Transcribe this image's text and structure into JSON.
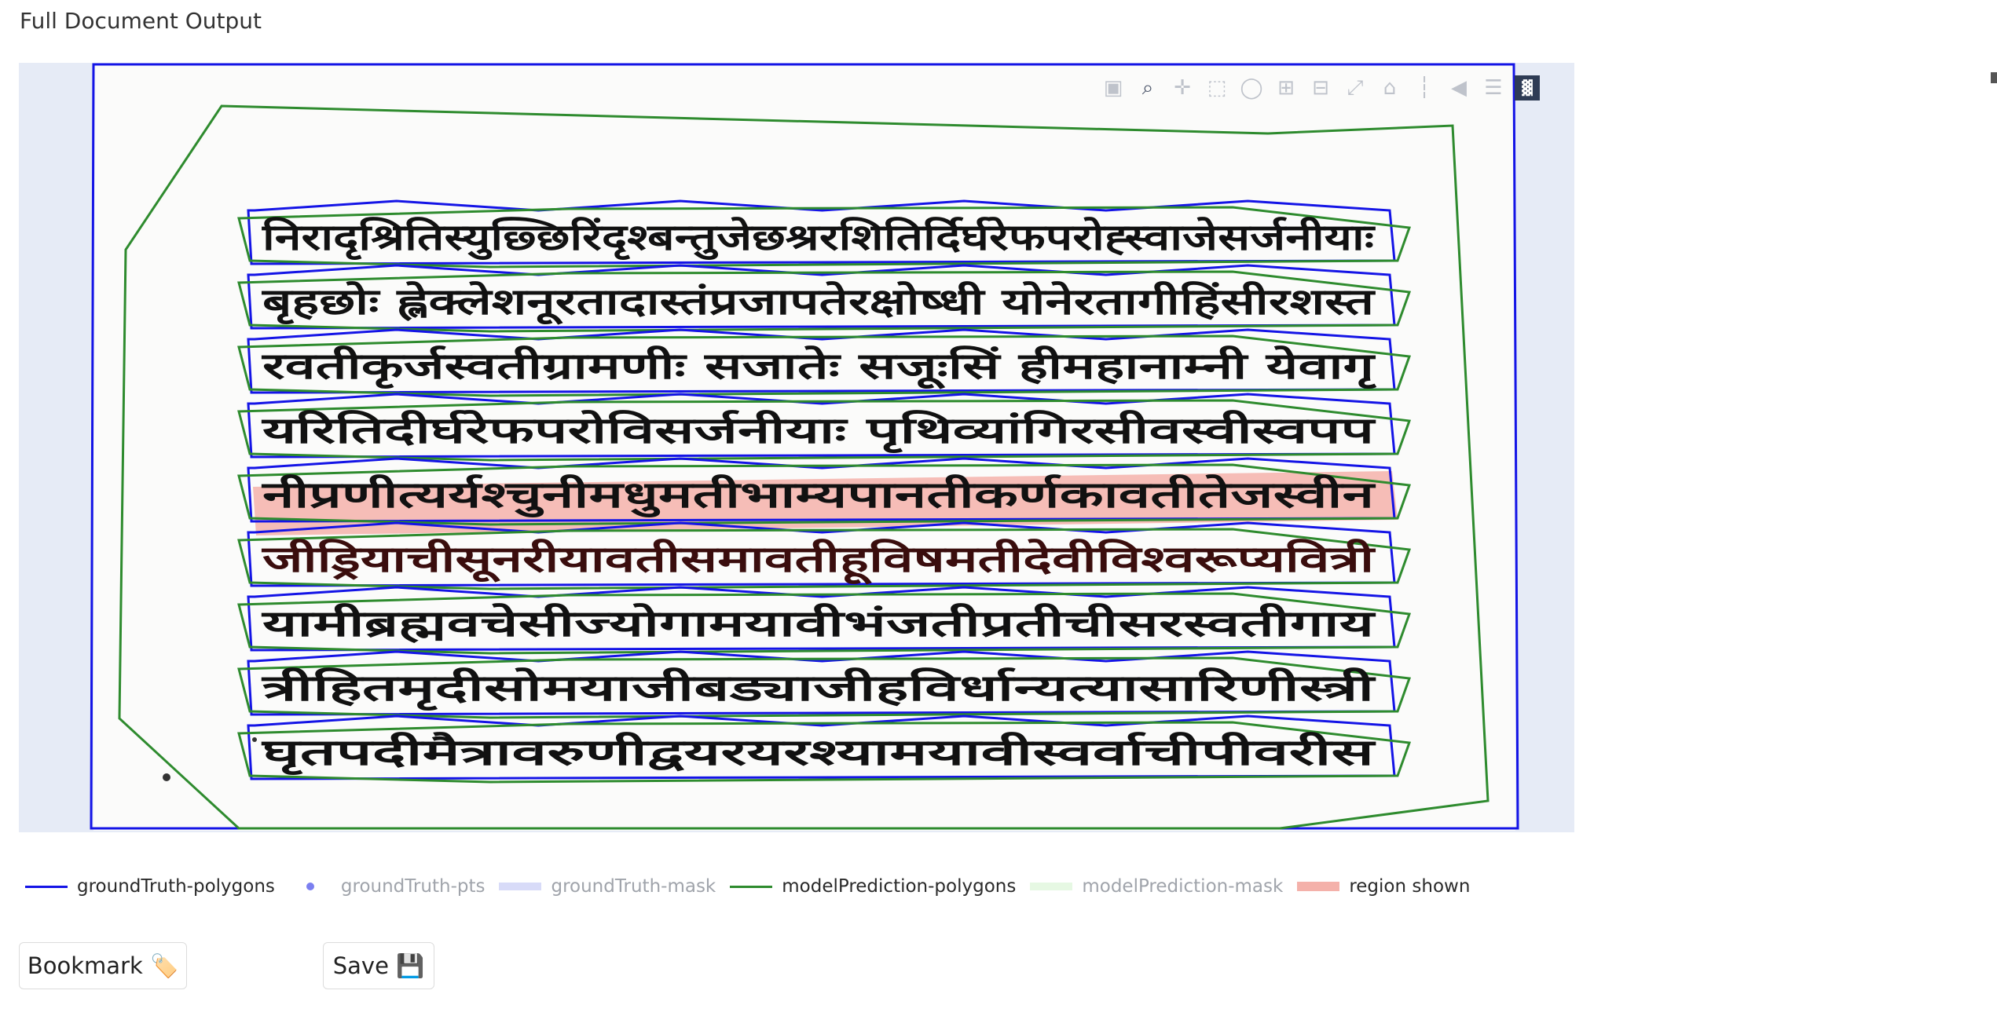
{
  "header": {
    "title": "Full Document Output"
  },
  "colors": {
    "groundtruth": "#1414e6",
    "prediction": "#2e8b2e",
    "region_shown": "#f4b1aa",
    "plot_bg": "#e6ebf6"
  },
  "modebar": {
    "buttons": [
      "camera-icon",
      "zoom-icon",
      "pan-icon",
      "box-select-icon",
      "lasso-select-icon",
      "zoom-in-icon",
      "zoom-out-icon",
      "autoscale-icon",
      "reset-axes-icon",
      "spike-lines-icon",
      "hover-closest-icon",
      "hover-compare-icon",
      "plotly-logo-icon"
    ],
    "active": "zoom-icon"
  },
  "document": {
    "script_lines": [
      "निरादृश्रितिस्युछ्छिरिंदृश्बन्तुजेछश्ररशितिर्दिर्घरेफपरोह्स्वाजेसर्जनीयाः",
      "बृहछोः ह्लेक्लेशनूरतादास्तंप्रजापतेरक्षोष्धी योनेरतागीहिंसीरशस्त",
      "रवतीकृर्जस्वतीग्रामणीः सजातेः सजूःसिं हीमहानाम्नी येवागृ",
      "यरितिदीर्घरेफपरोविसर्जनीयाः पृथिव्यांगिरसीवस्वीस्वपप",
      "नीप्रणीत्यर्यश्चुनीमधुमतीभाम्यपानतीकर्णकावतीतेजस्वीन",
      "जीड्रियाचीसूनरीयावतीसमावतीहूविषमतीदेवीविश्वरूप्यवित्री",
      "यामीब्रह्मवचेसीज्योगामयावीभंजतीप्रतीचीसरस्वतीगाय",
      "त्रीहितमृदीसोमयाजीबड्याजीहविर्धान्यत्यासारिणीस्त्री",
      "घृतपदीमैत्रावरुणीद्वयरयरश्यामयावीस्वर्वाचीपीवरीस"
    ]
  },
  "legend": [
    {
      "label": "groundTruth-polygons",
      "enabled": true,
      "swatch": "line-blue"
    },
    {
      "label": "groundTruth-pts",
      "enabled": false,
      "swatch": "dot"
    },
    {
      "label": "groundTruth-mask",
      "enabled": false,
      "swatch": "fill-blue"
    },
    {
      "label": "modelPrediction-polygons",
      "enabled": true,
      "swatch": "line-green"
    },
    {
      "label": "modelPrediction-mask",
      "enabled": false,
      "swatch": "fill-green"
    },
    {
      "label": "region shown",
      "enabled": true,
      "swatch": "fill-red"
    }
  ],
  "buttons": {
    "bookmark_label": "Bookmark 🏷️",
    "save_label": "Save 💾"
  }
}
